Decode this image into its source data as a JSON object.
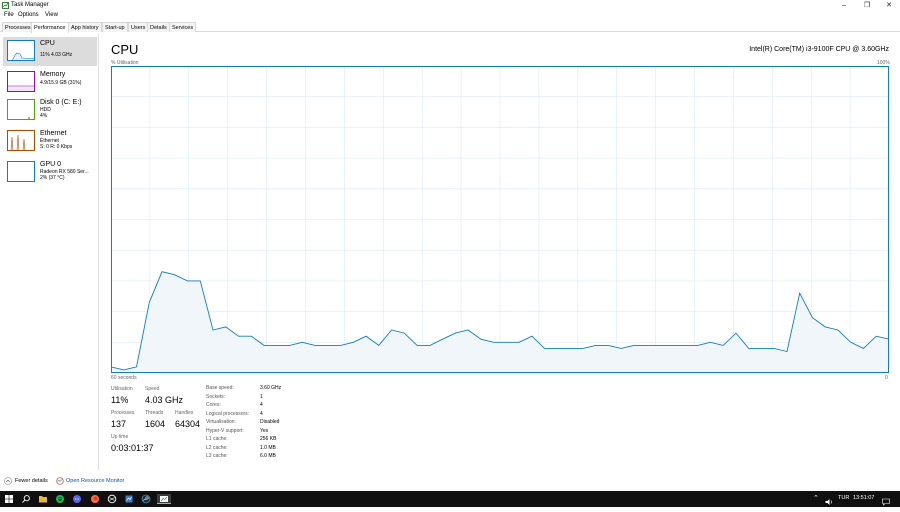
{
  "window": {
    "title": "Task Manager"
  },
  "menu": [
    "File",
    "Options",
    "View"
  ],
  "tabs": [
    "Processes",
    "Performance",
    "App history",
    "Start-up",
    "Users",
    "Details",
    "Services"
  ],
  "sidebar": [
    {
      "title": "CPU",
      "sub1": "11% 4.03 GHz",
      "sub2": "",
      "color": "#117dbb"
    },
    {
      "title": "Memory",
      "sub1": "4.9/15.9 GB (31%)",
      "sub2": "",
      "color": "#8b12ae"
    },
    {
      "title": "Disk 0 (C: E:)",
      "sub1": "HDD",
      "sub2": "4%",
      "color": "#4da60c"
    },
    {
      "title": "Ethernet",
      "sub1": "Ethernet",
      "sub2": "S: 0  R: 0 Kbps",
      "color": "#a74f01"
    },
    {
      "title": "GPU 0",
      "sub1": "Radeon RX 580 Ser...",
      "sub2": "2% (37 °C)",
      "color": "#117dbb"
    }
  ],
  "main": {
    "title": "CPU",
    "model": "Intel(R) Core(TM) i3-9100F CPU @ 3.60GHz",
    "util_label": "% Utilisation",
    "max_label": "100%",
    "time_label": "60 seconds",
    "zero_label": "0"
  },
  "graph": {
    "accent": "#117dbb",
    "fill": "#f1f6fa",
    "grid": "#d9eaf4",
    "values": [
      2,
      1,
      2,
      23,
      33,
      32,
      30,
      30,
      14,
      15,
      12,
      12,
      9,
      9,
      9,
      10,
      9,
      9,
      9,
      10,
      12,
      9,
      14,
      13,
      9,
      9,
      11,
      13,
      14,
      11,
      10,
      10,
      10,
      12,
      8,
      8,
      8,
      8,
      9,
      9,
      8,
      9,
      9,
      9,
      9,
      9,
      9,
      10,
      9,
      13,
      8,
      8,
      8,
      7,
      26,
      18,
      15,
      14,
      10,
      8,
      12,
      11
    ]
  },
  "stats": {
    "utilisation_label": "Utilisation",
    "utilisation": "11%",
    "speed_label": "Speed",
    "speed": "4.03 GHz",
    "processes_label": "Processes",
    "processes": "137",
    "threads_label": "Threads",
    "threads": "1604",
    "handles_label": "Handles",
    "handles": "64304",
    "uptime_label": "Up time",
    "uptime": "0:03:01:37"
  },
  "specs": [
    [
      "Base speed:",
      "3.60 GHz"
    ],
    [
      "Sockets:",
      "1"
    ],
    [
      "Cores:",
      "4"
    ],
    [
      "Logical processors:",
      "4"
    ],
    [
      "Virtualisation:",
      "Disabled"
    ],
    [
      "Hyper-V support:",
      "Yes"
    ],
    [
      "L1 cache:",
      "256 KB"
    ],
    [
      "L2 cache:",
      "1.0 MB"
    ],
    [
      "L3 cache:",
      "6.0 MB"
    ]
  ],
  "footer": {
    "fewer": "Fewer details",
    "monitor": "Open Resource Monitor"
  },
  "taskbar": {
    "lang": "TUR",
    "time": "13:51:07"
  }
}
